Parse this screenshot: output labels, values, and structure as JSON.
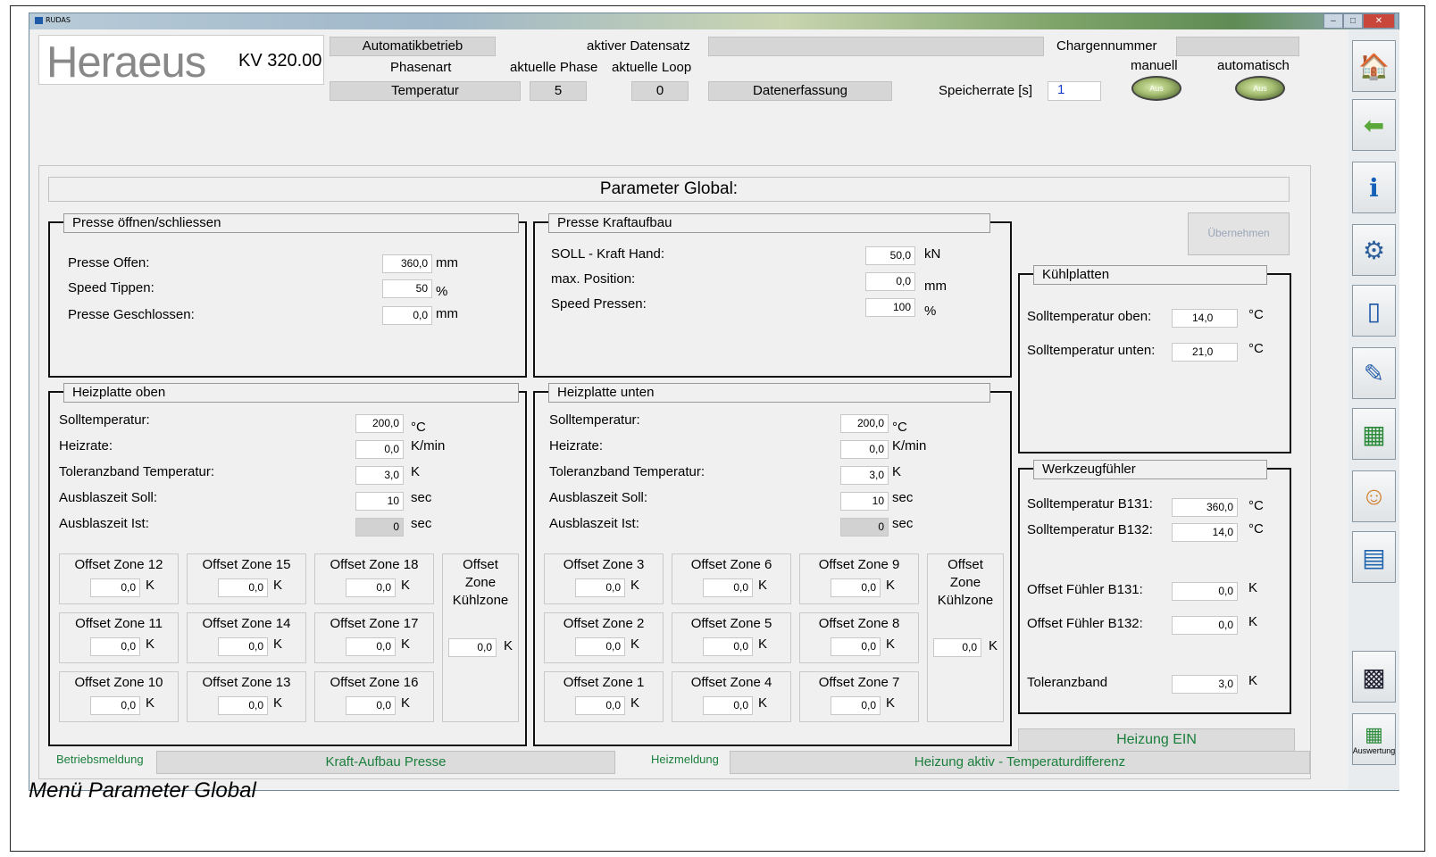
{
  "window": {
    "title": "RUDAS",
    "minimize": "–",
    "maximize": "□",
    "close": "✕"
  },
  "logo": {
    "brand": "Heraeus",
    "model": "KV 320.00"
  },
  "header": {
    "mode": "Automatikbetrieb",
    "phase_type_label": "Phasenart",
    "phase_type": "Temperatur",
    "active_dataset_label": "aktiver Datensatz",
    "active_dataset": "",
    "current_phase_label": "aktuelle Phase",
    "current_phase": "5",
    "current_loop_label": "aktuelle Loop",
    "current_loop": "0",
    "data_capture": "Datenerfassung",
    "batch_label": "Chargennummer",
    "batch": "",
    "save_rate_label": "Speicherrate [s]",
    "save_rate": "1",
    "manual_label": "manuell",
    "auto_label": "automatisch",
    "toggle_text": "Aus"
  },
  "page_title": "Parameter Global:",
  "apply_button": "Übernehmen",
  "presse": {
    "title": "Presse öffnen/schliessen",
    "rows": [
      {
        "label": "Presse Offen:",
        "value": "360,0",
        "unit": "mm"
      },
      {
        "label": "Speed Tippen:",
        "value": "50",
        "unit": "%"
      },
      {
        "label": "Presse Geschlossen:",
        "value": "0,0",
        "unit": "mm"
      }
    ]
  },
  "kraft": {
    "title": "Presse Kraftaufbau",
    "rows": [
      {
        "label": "SOLL - Kraft Hand:",
        "value": "50,0",
        "unit": "kN"
      },
      {
        "label": "max. Position:",
        "value": "0,0",
        "unit": "mm"
      },
      {
        "label": "Speed Pressen:",
        "value": "100",
        "unit": "%"
      }
    ]
  },
  "heiz_oben": {
    "title": "Heizplatte oben",
    "rows": [
      {
        "label": "Solltemperatur:",
        "value": "200,0",
        "unit": "°C"
      },
      {
        "label": "Heizrate:",
        "value": "0,0",
        "unit": "K/min"
      },
      {
        "label": "Toleranzband Temperatur:",
        "value": "3,0",
        "unit": "K"
      },
      {
        "label": "Ausblaszeit Soll:",
        "value": "10",
        "unit": "sec"
      },
      {
        "label": "Ausblaszeit Ist:",
        "value": "0",
        "unit": "sec"
      }
    ],
    "zones": [
      [
        "Offset Zone 12",
        "Offset Zone 15",
        "Offset Zone 18"
      ],
      [
        "Offset Zone 11",
        "Offset Zone 14",
        "Offset Zone 17"
      ],
      [
        "Offset Zone 10",
        "Offset Zone 13",
        "Offset Zone 16"
      ]
    ],
    "cool_label": "Offset\nZone\nKühlzone"
  },
  "heiz_unten": {
    "title": "Heizplatte unten",
    "rows": [
      {
        "label": "Solltemperatur:",
        "value": "200,0",
        "unit": "°C"
      },
      {
        "label": "Heizrate:",
        "value": "0,0",
        "unit": "K/min"
      },
      {
        "label": "Toleranzband Temperatur:",
        "value": "3,0",
        "unit": "K"
      },
      {
        "label": "Ausblaszeit Soll:",
        "value": "10",
        "unit": "sec"
      },
      {
        "label": "Ausblaszeit Ist:",
        "value": "0",
        "unit": "sec"
      }
    ],
    "zones": [
      [
        "Offset Zone 3",
        "Offset Zone 6",
        "Offset Zone 9"
      ],
      [
        "Offset Zone 2",
        "Offset Zone 5",
        "Offset Zone 8"
      ],
      [
        "Offset Zone 1",
        "Offset Zone 4",
        "Offset Zone 7"
      ]
    ],
    "cool_label": "Offset\nZone\nKühlzone"
  },
  "zone_value": "0,0",
  "zone_unit": "K",
  "kuehl": {
    "title": "Kühlplatten",
    "rows": [
      {
        "label": "Solltemperatur oben:",
        "value": "14,0",
        "unit": "°C"
      },
      {
        "label": "Solltemperatur unten:",
        "value": "21,0",
        "unit": "°C"
      }
    ]
  },
  "werkzeug": {
    "title": "Werkzeugfühler",
    "rows": [
      {
        "label": "Solltemperatur B131:",
        "value": "360,0",
        "unit": "°C"
      },
      {
        "label": "Solltemperatur B132:",
        "value": "14,0",
        "unit": "°C"
      },
      {
        "label": "Offset Fühler B131:",
        "value": "0,0",
        "unit": "K"
      },
      {
        "label": "Offset Fühler B132:",
        "value": "0,0",
        "unit": "K"
      },
      {
        "label": "Toleranzband",
        "value": "3,0",
        "unit": "K"
      }
    ]
  },
  "heizung_status": "Heizung EIN",
  "footer": {
    "betrieb_label": "Betriebsmeldung",
    "betrieb": "Kraft-Aufbau Presse",
    "heiz_label": "Heizmeldung",
    "heiz": "Heizung aktiv - Temperaturdifferenz"
  },
  "sidebar": {
    "auswertung": "Auswertung"
  },
  "caption": "Menü Parameter Global"
}
